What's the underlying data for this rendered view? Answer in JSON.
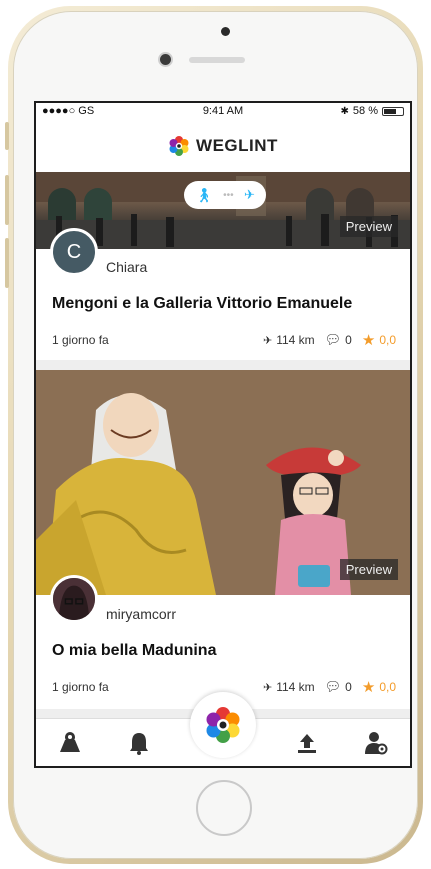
{
  "status_bar": {
    "carrier": "●●●●○ GS",
    "time": "9:41 AM",
    "battery": "58 %"
  },
  "app": {
    "name": "WEGLINT",
    "brand_color": "#111111"
  },
  "feed": [
    {
      "user": "Chiara",
      "avatar_letter": "C",
      "avatar_color": "#455a64",
      "title": "Mengoni e la Galleria Vittorio Emanuele",
      "time_ago": "1 giorno fa",
      "distance": "114 km",
      "comments": "0",
      "rating": "0,0",
      "preview_label": "Preview"
    },
    {
      "user": "miryamcorr",
      "title": "O mia bella Madunina",
      "time_ago": "1 giorno fa",
      "distance": "114 km",
      "comments": "0",
      "rating": "0,0",
      "preview_label": "Preview"
    }
  ],
  "tabs": [
    {
      "icon": "map-icon"
    },
    {
      "icon": "bell-icon"
    },
    {
      "icon": "weglint-flower-icon"
    },
    {
      "icon": "upload-icon"
    },
    {
      "icon": "user-settings-icon"
    }
  ],
  "colors": {
    "accent": "#f39c2b",
    "walk_icon": "#29b6f6"
  }
}
